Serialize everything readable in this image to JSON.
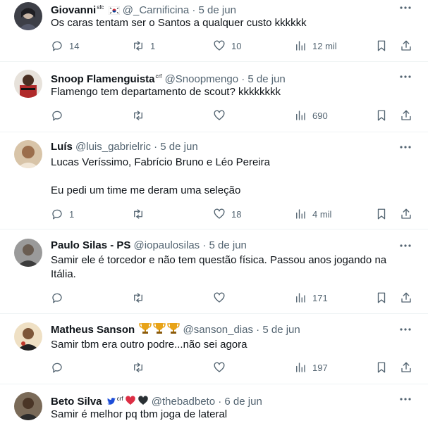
{
  "tweets": [
    {
      "name": "Giovanni",
      "name_sup": "sfc",
      "handle": "@_Carnificina",
      "time": "5 de jun",
      "badges": [
        "flag-kr-icon"
      ],
      "text_lines": [
        "Os caras tentam ser o Santos a qualquer custo kkkkkk"
      ],
      "replies": "14",
      "reposts": "1",
      "likes": "10",
      "views": "12 mil",
      "avatar_color": "#6b6f7a"
    },
    {
      "name": "Snoop Flamenguista",
      "name_sup": "crf",
      "handle": "@Snoopmengo",
      "time": "5 de jun",
      "badges": [],
      "text_lines": [
        "Flamengo tem departamento de scout? kkkkkkkk"
      ],
      "replies": "",
      "reposts": "",
      "likes": "",
      "views": "690",
      "avatar_color": "#b02a2a"
    },
    {
      "name": "Luís",
      "name_sup": "",
      "handle": "@luis_gabrielric",
      "time": "5 de jun",
      "badges": [],
      "text_lines": [
        "Lucas Veríssimo, Fabrício Bruno e Léo Pereira",
        "",
        "Eu pedi um time me deram uma seleção"
      ],
      "replies": "1",
      "reposts": "",
      "likes": "18",
      "views": "4 mil",
      "avatar_color": "#c8a27a"
    },
    {
      "name": "Paulo Silas - PS",
      "name_sup": "",
      "handle": "@iopaulosilas",
      "time": "5 de jun",
      "badges": [],
      "text_lines": [
        "Samir ele é torcedor e não tem questão física. Passou anos jogando na",
        "Itália."
      ],
      "replies": "",
      "reposts": "",
      "likes": "",
      "views": "171",
      "avatar_color": "#8d8d8d"
    },
    {
      "name": "Matheus Sanson",
      "name_sup": "",
      "handle": "@sanson_dias",
      "time": "5 de jun",
      "badges": [
        "trophy-icon",
        "trophy-icon",
        "trophy-icon"
      ],
      "text_lines": [
        "Samir tbm era outro podre...não sei agora"
      ],
      "replies": "",
      "reposts": "",
      "likes": "",
      "views": "197",
      "avatar_color": "#d9b98a"
    },
    {
      "name": "Beto Silva",
      "name_sup": "crf",
      "handle": "@thebadbeto",
      "time": "6 de jun",
      "badges": [
        "bird-icon",
        "red-heart-icon",
        "black-heart-icon"
      ],
      "text_lines": [
        "Samir é melhor pq tbm joga de lateral"
      ],
      "replies": "",
      "reposts": "",
      "likes": "",
      "views": "",
      "avatar_color": "#5a4a3a"
    }
  ],
  "colors": {
    "text": "#0f1419",
    "secondary": "#536471",
    "divider": "#eff3f4"
  }
}
